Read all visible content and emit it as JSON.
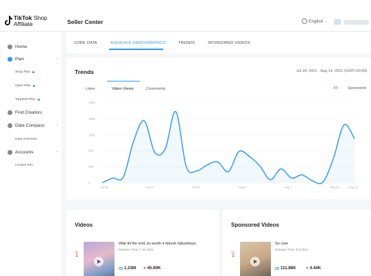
{
  "brand": {
    "name": "TikTok",
    "suffix": "Shop",
    "sub": "Affiliate"
  },
  "header": {
    "title": "Seller Center",
    "language": "English"
  },
  "sidebar": {
    "items": [
      {
        "label": "Home"
      },
      {
        "label": "Plan"
      },
      {
        "label": "Find Creators"
      },
      {
        "label": "Data Compass"
      },
      {
        "label": "Accounts"
      }
    ],
    "plan_sub": [
      "Shop Plan",
      "Open Plan",
      "Targeted Plan"
    ],
    "data_sub": [
      "Data Overview"
    ],
    "accounts_sub": [
      "Contact Info"
    ]
  },
  "tabs": [
    "CORE DATA",
    "AUDIENCE DEMOGRAPHICS",
    "TRENDS",
    "SPONSORED VIDEOS"
  ],
  "trends": {
    "title": "Trends",
    "date_range": "Jul 18, 2021 - Aug 14, 2021 (GMT+00:00)",
    "metric_tabs": [
      "Likes",
      "Video Views",
      "Comments"
    ],
    "filter_tabs": [
      "All",
      "Sponsored"
    ]
  },
  "chart_data": {
    "type": "line",
    "series": [
      {
        "values": [
          0,
          12,
          14,
          105,
          155,
          76,
          85,
          178,
          40,
          30,
          45,
          52,
          28,
          78,
          66,
          42,
          8,
          35,
          12,
          20,
          5,
          2,
          62,
          145,
          110
        ]
      }
    ],
    "y_ticks": [
      "0",
      "40K",
      "80K",
      "120K",
      "160K",
      "200K"
    ],
    "x_ticks": [
      "Jul 18",
      "Jul 23",
      "Jul 28",
      "Aug 3",
      "Aug 7",
      "Aug 12",
      "Aug 14"
    ],
    "color": "#3ba0f6",
    "grid": true
  },
  "videos": {
    "title": "Videos",
    "rank_label": "No.",
    "rank": "1",
    "video_title": "Wait till the end, its worth it #plush #plushtoys",
    "release": "Release Time: 7.22.2021",
    "views": "1.33M",
    "likes": "45.90K"
  },
  "sponsored": {
    "title": "Sponsored Videos",
    "rank_label": "No.",
    "rank": "1",
    "video_title": "So cute",
    "release": "Release Time: 8.3.2021",
    "views": "111.88K",
    "likes": "4.44K"
  },
  "colors": {
    "accent": "#2b95ff",
    "line": "#3ba0f6",
    "heart": "#ef4f78",
    "rank": "#e8564f"
  }
}
